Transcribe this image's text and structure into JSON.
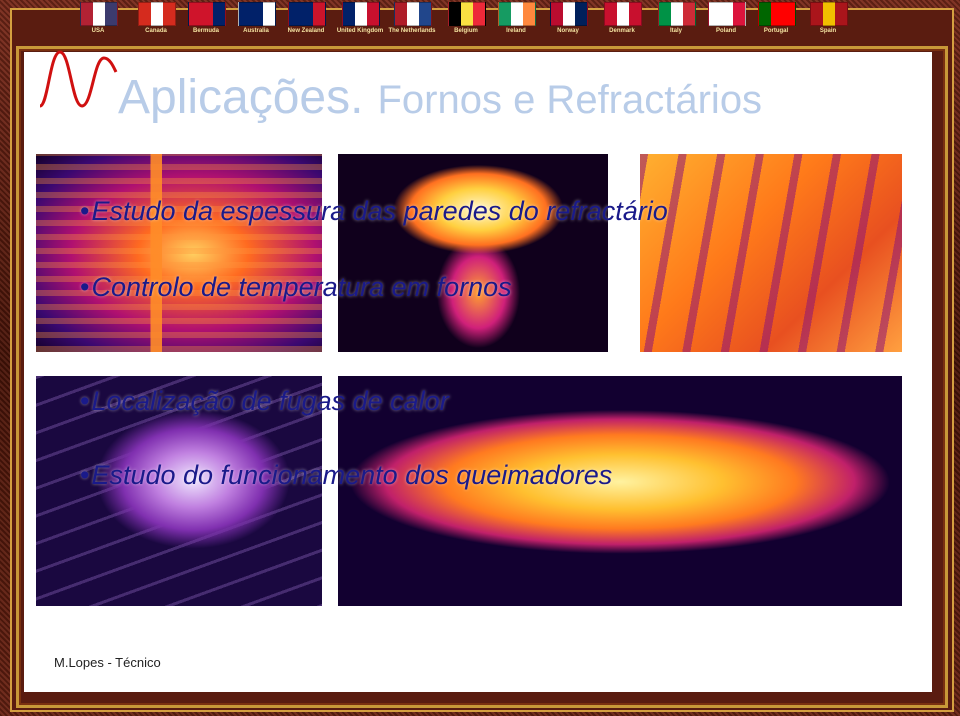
{
  "flags": [
    {
      "label": "USA",
      "colors": [
        "#b22234",
        "#ffffff",
        "#3c3b6e"
      ]
    },
    {
      "label": "Canada",
      "colors": [
        "#d52b1e",
        "#ffffff",
        "#d52b1e"
      ]
    },
    {
      "label": "Bermuda",
      "colors": [
        "#cf142b",
        "#cf142b",
        "#012169"
      ]
    },
    {
      "label": "Australia",
      "colors": [
        "#012169",
        "#012169",
        "#ffffff"
      ]
    },
    {
      "label": "New Zealand",
      "colors": [
        "#012169",
        "#012169",
        "#cc142b"
      ]
    },
    {
      "label": "United Kingdom",
      "colors": [
        "#012169",
        "#ffffff",
        "#c8102e"
      ]
    },
    {
      "label": "The Netherlands",
      "colors": [
        "#ae1c28",
        "#ffffff",
        "#21468b"
      ]
    },
    {
      "label": "Belgium",
      "colors": [
        "#000000",
        "#fae042",
        "#ed2939"
      ]
    },
    {
      "label": "Ireland",
      "colors": [
        "#169b62",
        "#ffffff",
        "#ff883e"
      ]
    },
    {
      "label": "Norway",
      "colors": [
        "#ba0c2f",
        "#ffffff",
        "#00205b"
      ]
    },
    {
      "label": "Denmark",
      "colors": [
        "#c8102e",
        "#ffffff",
        "#c8102e"
      ]
    },
    {
      "label": "Italy",
      "colors": [
        "#009246",
        "#ffffff",
        "#ce2b37"
      ]
    },
    {
      "label": "Poland",
      "colors": [
        "#ffffff",
        "#ffffff",
        "#dc143c"
      ]
    },
    {
      "label": "Portugal",
      "colors": [
        "#006600",
        "#ff0000",
        "#ff0000"
      ]
    },
    {
      "label": "Spain",
      "colors": [
        "#aa151b",
        "#f1bf00",
        "#aa151b"
      ]
    }
  ],
  "slide": {
    "title": "Aplicações.",
    "subtitle": "Fornos e  Refractários",
    "bullets": [
      "Estudo da espessura das paredes do refractário",
      "Controlo de temperatura em fornos",
      "Localização de fugas de calor",
      "Estudo do funcionamento dos queimadores"
    ],
    "footer": "M.Lopes - Técnico"
  },
  "colors": {
    "title": "#b8cce8",
    "bullet": "#1a1a8a",
    "frame_gold": "#c89838"
  }
}
